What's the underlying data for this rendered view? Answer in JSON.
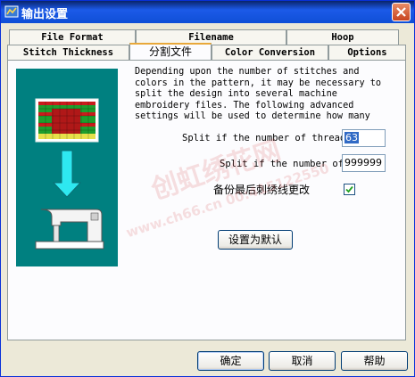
{
  "window": {
    "title": "输出设置"
  },
  "tabs": {
    "row_back": [
      "File Format",
      "Filename",
      "Hoop"
    ],
    "row_front": [
      "Stitch Thickness",
      "分割文件",
      "Color Conversion",
      "Options"
    ],
    "active": "分割文件"
  },
  "panel": {
    "description": "Depending upon the number of stitches and colors in the pattern, it may be necessary to split the design into several machine embroidery files. The following advanced settings will be used to determine how many",
    "split_threads_label": "Split if the number of thread",
    "split_threads_value": "63",
    "split_stitches_label": "Split if the number of",
    "split_stitches_value": "999999",
    "backup_label": "备份最后刺绣线更改",
    "backup_checked": true,
    "defaults_button": "设置为默认"
  },
  "footer": {
    "ok": "确定",
    "cancel": "取消",
    "help": "帮助"
  },
  "watermark": {
    "brand": "创虹绣花网",
    "line": "www.ch66.cn 00:415122550"
  }
}
